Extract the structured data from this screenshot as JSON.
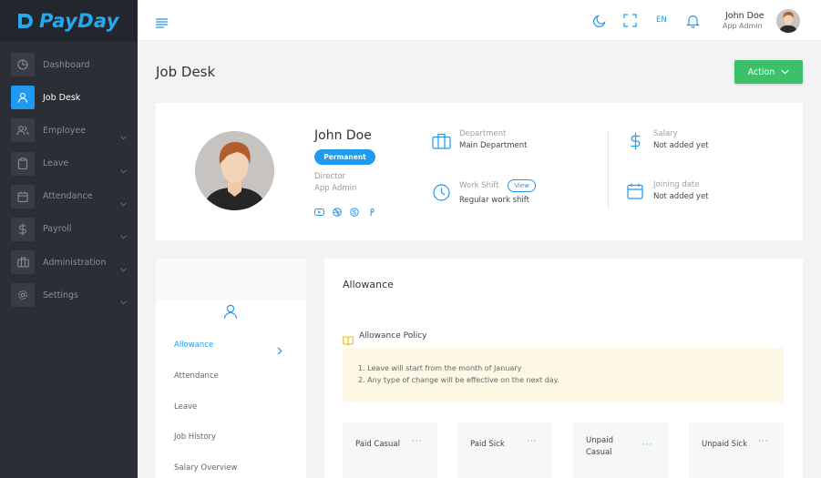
{
  "brand": {
    "name": "PayDay"
  },
  "sidebar": {
    "items": [
      {
        "label": "Dashboard",
        "icon": "dashboard-icon",
        "active": false,
        "expandable": false
      },
      {
        "label": "Job Desk",
        "icon": "user-icon",
        "active": true,
        "expandable": false
      },
      {
        "label": "Employee",
        "icon": "users-icon",
        "active": false,
        "expandable": true
      },
      {
        "label": "Leave",
        "icon": "clipboard-icon",
        "active": false,
        "expandable": true
      },
      {
        "label": "Attendance",
        "icon": "calendar-icon",
        "active": false,
        "expandable": true
      },
      {
        "label": "Payroll",
        "icon": "dollar-icon",
        "active": false,
        "expandable": true
      },
      {
        "label": "Administration",
        "icon": "briefcase-icon",
        "active": false,
        "expandable": true
      },
      {
        "label": "Settings",
        "icon": "gear-icon",
        "active": false,
        "expandable": true
      }
    ]
  },
  "topbar": {
    "language": "EN",
    "user_name": "John Doe",
    "user_role": "App Admin"
  },
  "page": {
    "title": "Job Desk",
    "action_label": "Action"
  },
  "profile": {
    "name": "John Doe",
    "status": "Permanent",
    "designation": "Director",
    "role": "App Admin",
    "socials": [
      "youtube-icon",
      "dribbble-icon",
      "skype-icon",
      "pinterest-icon"
    ],
    "department_label": "Department",
    "department_value": "Main Department",
    "workshift_label": "Work Shift",
    "workshift_view": "View",
    "workshift_value": "Regular work shift",
    "salary_label": "Salary",
    "salary_value": "Not added yet",
    "joining_label": "Joining date",
    "joining_value": "Not added yet"
  },
  "tabs": {
    "items": [
      "Allowance",
      "Attendance",
      "Leave",
      "Job History",
      "Salary Overview"
    ],
    "active": "Allowance"
  },
  "allowance": {
    "title": "Allowance",
    "policy_title": "Allowance Policy",
    "policy_lines": [
      "1. Leave will start from the month of January",
      "2. Any type of change will be effective on the next day."
    ],
    "cards": [
      {
        "line1": "Paid Casual",
        "line2": ""
      },
      {
        "line1": "Paid Sick",
        "line2": ""
      },
      {
        "line1": "Unpaid",
        "line2": "Casual"
      },
      {
        "line1": "Unpaid Sick",
        "line2": ""
      }
    ],
    "card_menu": "···"
  },
  "colors": {
    "accent": "#1e9bf0",
    "sidebar_bg": "#2c2e36",
    "action_green": "#3cc06a",
    "policy_bg": "#fdf8e6"
  }
}
